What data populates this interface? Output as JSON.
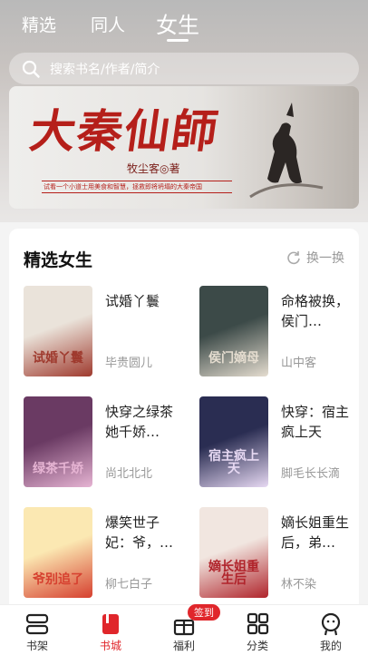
{
  "top_tabs": [
    "精选",
    "同人",
    "女生"
  ],
  "search": {
    "placeholder": "搜索书名/作者/简介"
  },
  "banner": {
    "title": "大秦仙師",
    "author": "牧尘客◎著",
    "tagline": "试看一个小道士用美食和智慧，拯救即将坍塌的大秦帝国"
  },
  "section": {
    "title": "精选女生",
    "refresh_label": "换一换"
  },
  "books": [
    {
      "title": "试婚丫鬟",
      "author": "毕贵圆儿",
      "cover_text": "试婚丫鬟",
      "cover_colors": [
        "#eae3da",
        "#9f3a2e"
      ]
    },
    {
      "title": "命格被换，侯门…",
      "author": "山中客",
      "cover_text": "侯门嫡母",
      "cover_colors": [
        "#3c4a48",
        "#e5ddd0"
      ]
    },
    {
      "title": "快穿之绿茶她千娇…",
      "author": "尚北北北",
      "cover_text": "绿茶千娇",
      "cover_colors": [
        "#6a3a63",
        "#e6b4d3"
      ]
    },
    {
      "title": "快穿：宿主疯上天",
      "author": "脚毛长长滴",
      "cover_text": "宿主疯上天",
      "cover_colors": [
        "#2a2d52",
        "#e7d9f3"
      ]
    },
    {
      "title": "爆笑世子妃：爷，…",
      "author": "柳七白子",
      "cover_text": "爷别追了",
      "cover_colors": [
        "#fbe8b2",
        "#d6402f"
      ]
    },
    {
      "title": "嫡长姐重生后，弟…",
      "author": "林不染",
      "cover_text": "嫡长姐重生后",
      "cover_colors": [
        "#f1e6e0",
        "#b0242b"
      ]
    }
  ],
  "bottom_nav": [
    {
      "label": "书架",
      "icon": "bookshelf-icon"
    },
    {
      "label": "书城",
      "icon": "bookstore-icon"
    },
    {
      "label": "福利",
      "icon": "gift-icon",
      "badge": "签到"
    },
    {
      "label": "分类",
      "icon": "category-icon"
    },
    {
      "label": "我的",
      "icon": "profile-icon"
    }
  ],
  "colors": {
    "accent": "#e0262b",
    "banner_red": "#b51f1a"
  }
}
